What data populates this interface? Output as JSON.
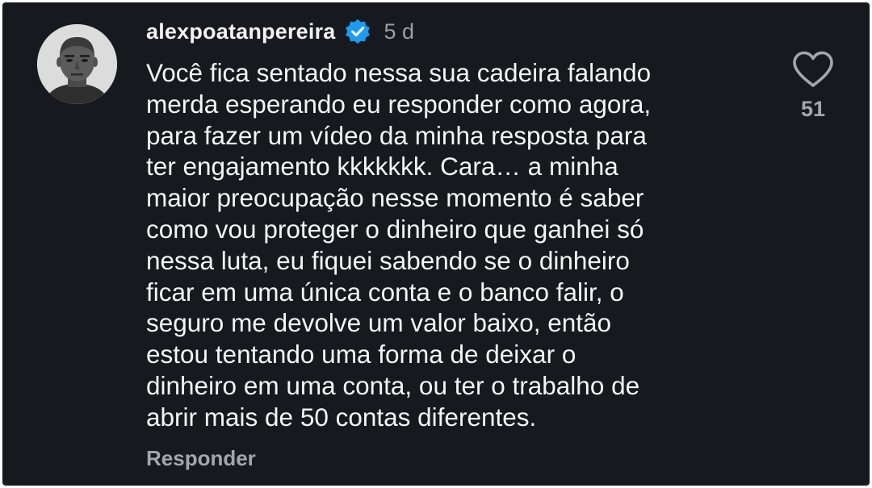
{
  "comment": {
    "username": "alexpoatanpereira",
    "verified": true,
    "time_ago": "5 d",
    "text_lines": [
      "Você fica sentado nessa sua cadeira falando",
      "merda esperando eu responder como agora,",
      "para fazer um vídeo da minha resposta para",
      "ter engajamento kkkkkkk. Cara… a minha",
      "maior preocupação nesse momento é saber",
      "como vou proteger o dinheiro que ganhei só",
      "nessa luta, eu fiquei sabendo se o dinheiro",
      "ficar em uma única conta e o banco falir, o",
      "seguro me devolve um valor baixo, então",
      "estou tentando uma forma de deixar o",
      "dinheiro em uma conta, ou ter o trabalho de",
      "abrir mais de 50 contas diferentes."
    ],
    "reply_label": "Responder",
    "like_count": "51"
  },
  "icons": {
    "avatar": "profile-photo",
    "verified": "verified-badge-icon",
    "like": "heart-outline-icon"
  },
  "colors": {
    "background": "#16191d",
    "verified_badge": "#1d9bf0",
    "primary_text": "#f5f5f5",
    "secondary_text": "#a3a6aa"
  }
}
